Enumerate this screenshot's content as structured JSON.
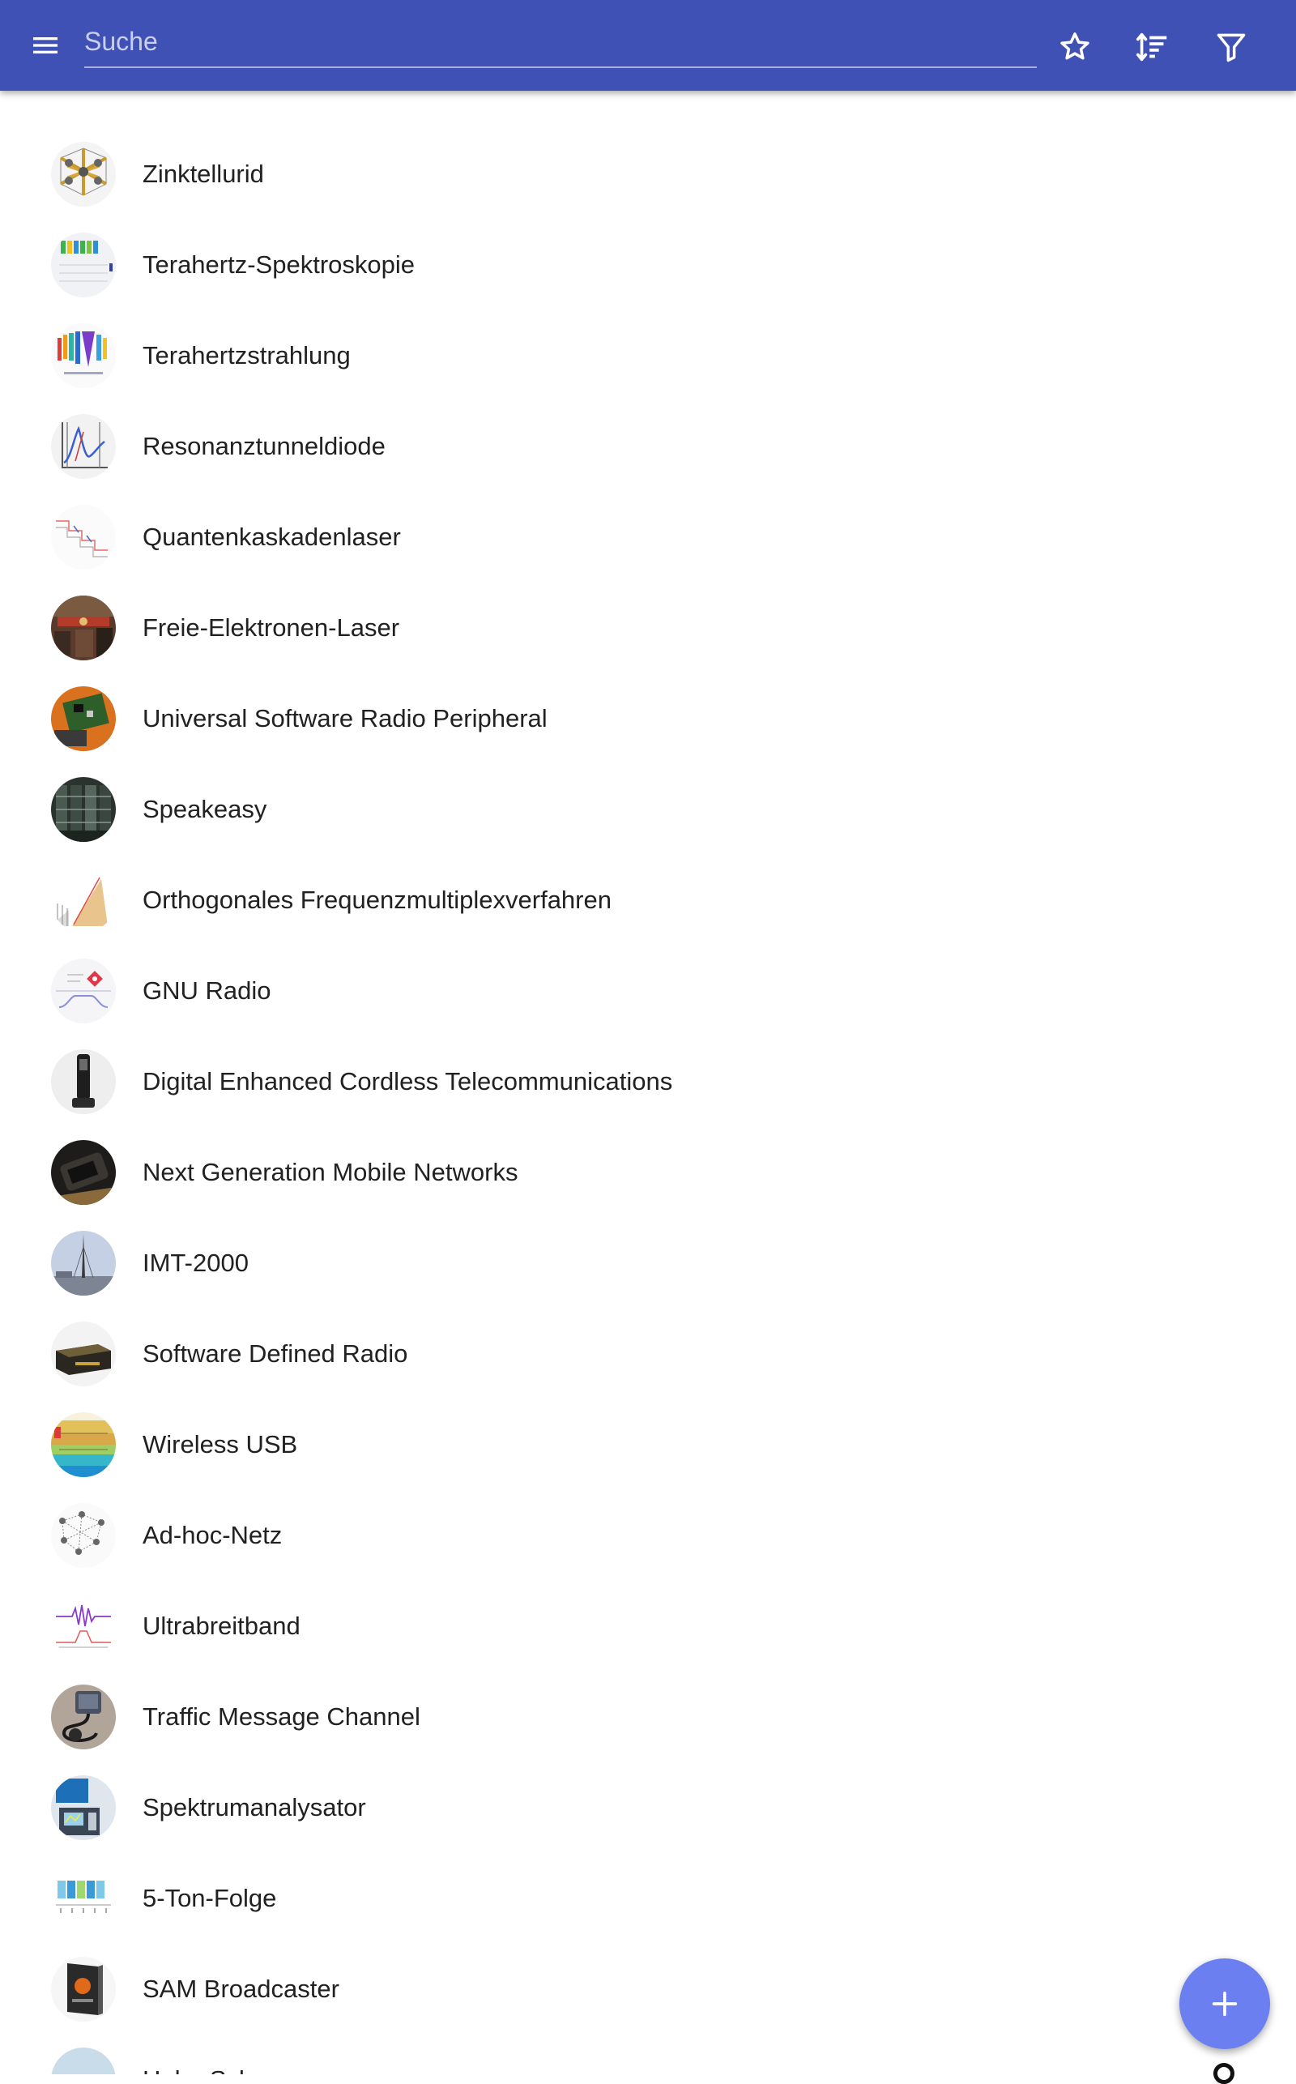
{
  "toolbar": {
    "search_placeholder": "Suche",
    "search_value": "",
    "menu_icon": "hamburger-menu-icon",
    "favorites_icon": "star-outline-icon",
    "sort_icon": "sort-icon",
    "filter_icon": "filter-icon"
  },
  "colors": {
    "app_bar": "#3f51b5",
    "fab": "#6b7ff0",
    "text": "#212121"
  },
  "articles": [
    {
      "title": "Zinktellurid",
      "thumb": "crystal-structure"
    },
    {
      "title": "Terahertz-Spektroskopie",
      "thumb": "spectrum-colored"
    },
    {
      "title": "Terahertzstrahlung",
      "thumb": "spectrum-bars"
    },
    {
      "title": "Resonanztunneldiode",
      "thumb": "iv-curve"
    },
    {
      "title": "Quantenkaskadenlaser",
      "thumb": "band-diagram"
    },
    {
      "title": "Freie-Elektronen-Laser",
      "thumb": "photo-lab"
    },
    {
      "title": "Universal Software Radio Peripheral",
      "thumb": "photo-board"
    },
    {
      "title": "Speakeasy",
      "thumb": "photo-rack"
    },
    {
      "title": "Orthogonales Frequenzmultiplexverfahren",
      "thumb": "ofdm-plot"
    },
    {
      "title": "GNU Radio",
      "thumb": "flowgraph"
    },
    {
      "title": "Digital Enhanced Cordless Telecommunications",
      "thumb": "phone"
    },
    {
      "title": "Next Generation Mobile Networks",
      "thumb": "photo-phone"
    },
    {
      "title": "IMT-2000",
      "thumb": "tower"
    },
    {
      "title": "Software Defined Radio",
      "thumb": "device-box"
    },
    {
      "title": "Wireless USB",
      "thumb": "spectrum-chart"
    },
    {
      "title": "Ad-hoc-Netz",
      "thumb": "network-graph"
    },
    {
      "title": "Ultrabreitband",
      "thumb": "waveform"
    },
    {
      "title": "Traffic Message Channel",
      "thumb": "gps-device"
    },
    {
      "title": "Spektrumanalysator",
      "thumb": "instrument"
    },
    {
      "title": "5-Ton-Folge",
      "thumb": "tone-sequence"
    },
    {
      "title": "SAM Broadcaster",
      "thumb": "software-box"
    },
    {
      "title": "Hohe Schwane",
      "thumb": "sky"
    }
  ],
  "fab": {
    "icon": "plus-icon"
  }
}
